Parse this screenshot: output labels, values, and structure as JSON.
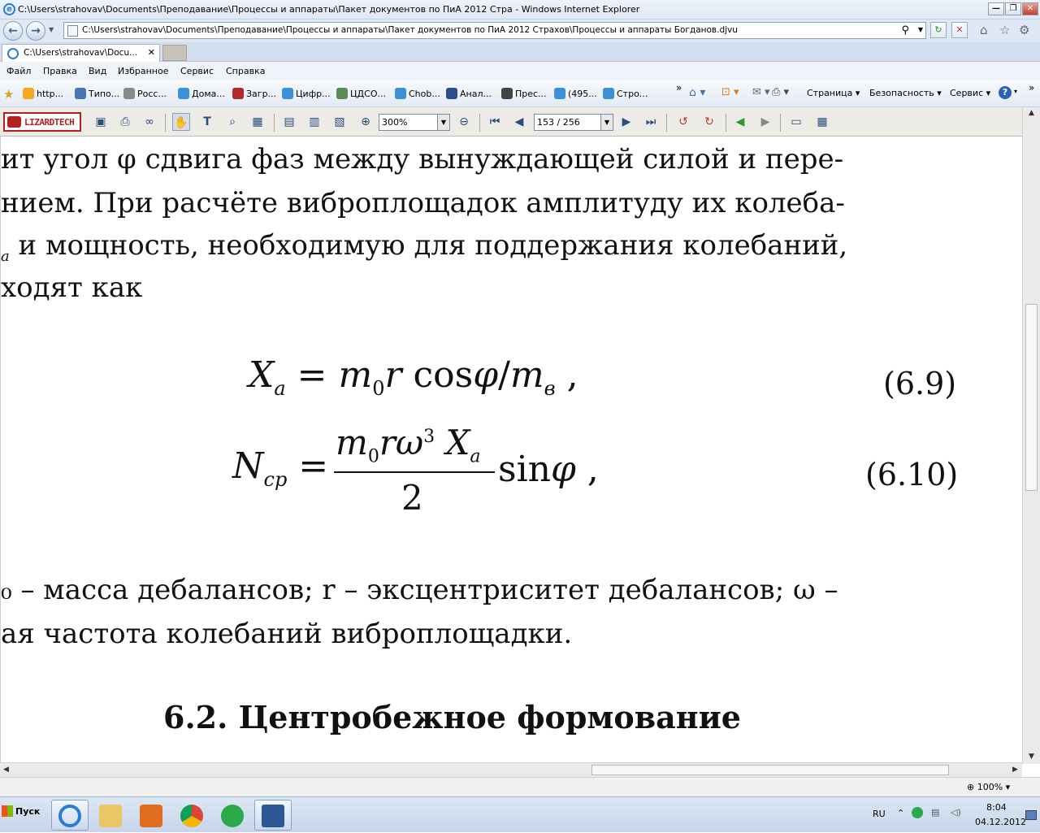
{
  "window": {
    "title": "C:\\Users\\strahovav\\Documents\\Преподавание\\Процессы и аппараты\\Пакет документов по ПиА 2012 Стра - Windows Internet Explorer",
    "min": "—",
    "max": "❐",
    "close": "✕"
  },
  "address": {
    "url": "C:\\Users\\strahovav\\Documents\\Преподавание\\Процессы и аппараты\\Пакет документов по ПиА 2012 Страхов\\Процессы и аппараты Богданов.djvu",
    "search_glyph": "⚲",
    "refresh_glyph": "↻",
    "stop_glyph": "✕"
  },
  "tab": {
    "label": "C:\\Users\\strahovav\\Docu...",
    "close": "✕"
  },
  "menu": [
    "Файл",
    "Правка",
    "Вид",
    "Избранное",
    "Сервис",
    "Справка"
  ],
  "favorites": [
    {
      "label": "http...",
      "color": "#f5a623"
    },
    {
      "label": "Типо...",
      "color": "#4a76b8"
    },
    {
      "label": "Росс...",
      "color": "#8a8a8a"
    },
    {
      "label": "Дома...",
      "color": "#3d8fd6"
    },
    {
      "label": "Загр...",
      "color": "#b02a2a"
    },
    {
      "label": "Цифр...",
      "color": "#3d8fd6"
    },
    {
      "label": "ЦДСО...",
      "color": "#5a8a5a"
    },
    {
      "label": "Chob...",
      "color": "#3d8fd6"
    },
    {
      "label": "Анал...",
      "color": "#2b4f8a"
    },
    {
      "label": "Прес...",
      "color": "#444444"
    },
    {
      "label": "(495...",
      "color": "#3d8fd6"
    },
    {
      "label": "Стро...",
      "color": "#3d8fd6"
    }
  ],
  "command_bar": {
    "page": "Страница ▾",
    "safety": "Безопасность ▾",
    "tools": "Сервис ▾",
    "help": "?"
  },
  "djvu": {
    "logo": "LIZARDTECH",
    "zoom": "300%",
    "page": "153 / 256"
  },
  "doc": {
    "line1": "ит угол φ сдвига фаз между вынуждающей силой и пере-",
    "line2": "нием. При расчёте виброплощадок амплитуду их колеба-",
    "line3_sub": "a",
    "line3": " и мощность, необходимую для поддержания колебаний,",
    "line4": "ходят как",
    "eq1": {
      "X": "X",
      "a": "a",
      "eqs": " = ",
      "m": "m",
      "zero": "0",
      "r": "r",
      "cos": " cos",
      "phi": "φ",
      "slash": "/",
      "m2": "m",
      "v": "в",
      "comma": " ,"
    },
    "eq1_num": "(6.9)",
    "eq2": {
      "N": "N",
      "cp": "ср",
      "eqs": " = ",
      "num_m": "m",
      "num_zero": "0",
      "num_r": "r",
      "num_w": "ω",
      "num_3": "3",
      "num_X": " X",
      "num_a": "a",
      "den": "2",
      "sin": "sin",
      "phi": "φ",
      "comma": " ,"
    },
    "eq2_num": "(6.10)",
    "line5_start": "₀",
    "line5": " – масса дебалансов; r – эксцентриситет дебалансов; ω –",
    "line6": "ая частота колебаний виброплощадки.",
    "heading": "6.2. Центробежное формование"
  },
  "status": {
    "zoom": "100%"
  },
  "taskbar": {
    "start": "Пуск",
    "lang": "RU",
    "time": "8:04",
    "date": "04.12.2012"
  }
}
